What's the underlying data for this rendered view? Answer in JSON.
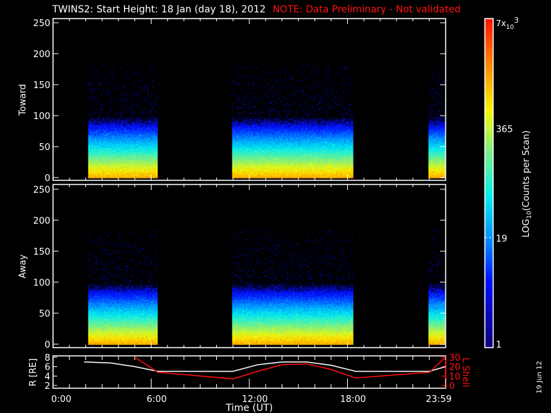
{
  "title": "TWINS2: Start Height: 18 Jan (day  18), 2012",
  "note": "NOTE: Data Preliminary - Not validated",
  "date_stamp": "19 Jun 12",
  "colors": {
    "note": "#ff1010",
    "r_line": "#ffffff",
    "l_line": "#ff1010"
  },
  "chart_data": [
    {
      "type": "heatmap",
      "panel": "Toward",
      "ylabel": "Toward",
      "ylim": [
        0,
        250
      ],
      "yticks": [
        "0",
        "50",
        "100",
        "150",
        "200",
        "250"
      ],
      "x_range_hours": [
        0,
        24
      ],
      "data_intervals_hours": [
        [
          2.15,
          6.4
        ],
        [
          10.95,
          18.35
        ],
        [
          22.95,
          24
        ]
      ],
      "max_height_with_counts": 185
    },
    {
      "type": "heatmap",
      "panel": "Away",
      "ylabel": "Away",
      "ylim": [
        0,
        250
      ],
      "yticks": [
        "0",
        "50",
        "100",
        "150",
        "200",
        "250"
      ],
      "x_range_hours": [
        0,
        24
      ],
      "data_intervals_hours": [
        [
          2.15,
          6.4
        ],
        [
          10.95,
          18.35
        ],
        [
          22.95,
          24
        ]
      ],
      "max_height_with_counts": 185
    },
    {
      "type": "line",
      "xlabel": "Time (UT)",
      "xticks": [
        "0:00",
        "6:00",
        "12:00",
        "18:00",
        "23:59"
      ],
      "ylabel": "R [RE]",
      "ylabel_right": "L Shell",
      "yticks_left": [
        "2",
        "4",
        "6",
        "8"
      ],
      "yticks_right": [
        "0",
        "10",
        "20",
        "30"
      ],
      "ylim_left": [
        1.5,
        8.3
      ],
      "ylim_right": [
        0,
        30
      ],
      "series": [
        {
          "name": "R",
          "axis": "left",
          "x": [
            1.9,
            3.5,
            5.0,
            6.4,
            11.0,
            12.5,
            14.0,
            15.5,
            17.0,
            18.5,
            23.0,
            24.0
          ],
          "y": [
            7.0,
            6.8,
            6.0,
            5.0,
            5.0,
            6.4,
            7.0,
            7.0,
            6.3,
            5.0,
            5.0,
            6.0
          ]
        },
        {
          "name": "L Shell",
          "axis": "right",
          "x": [
            5.0,
            6.4,
            11.0,
            12.5,
            14.0,
            15.5,
            17.0,
            18.5,
            23.0,
            24.0
          ],
          "y": [
            30,
            14,
            7,
            15,
            22,
            23,
            17,
            8,
            14,
            30
          ]
        }
      ]
    },
    {
      "type": "colorbar",
      "label": "LOG10(Counts per Scan)",
      "ticks": [
        "1",
        "19",
        "365",
        "7x10^3"
      ],
      "tick_values": [
        1,
        19,
        365,
        7000
      ]
    }
  ],
  "colorbar": {
    "label_main": "LOG",
    "label_sub": "10",
    "label_tail": "(Counts per Scan)",
    "top_base": "7x",
    "top_sub": "10",
    "top_sup": "3"
  }
}
